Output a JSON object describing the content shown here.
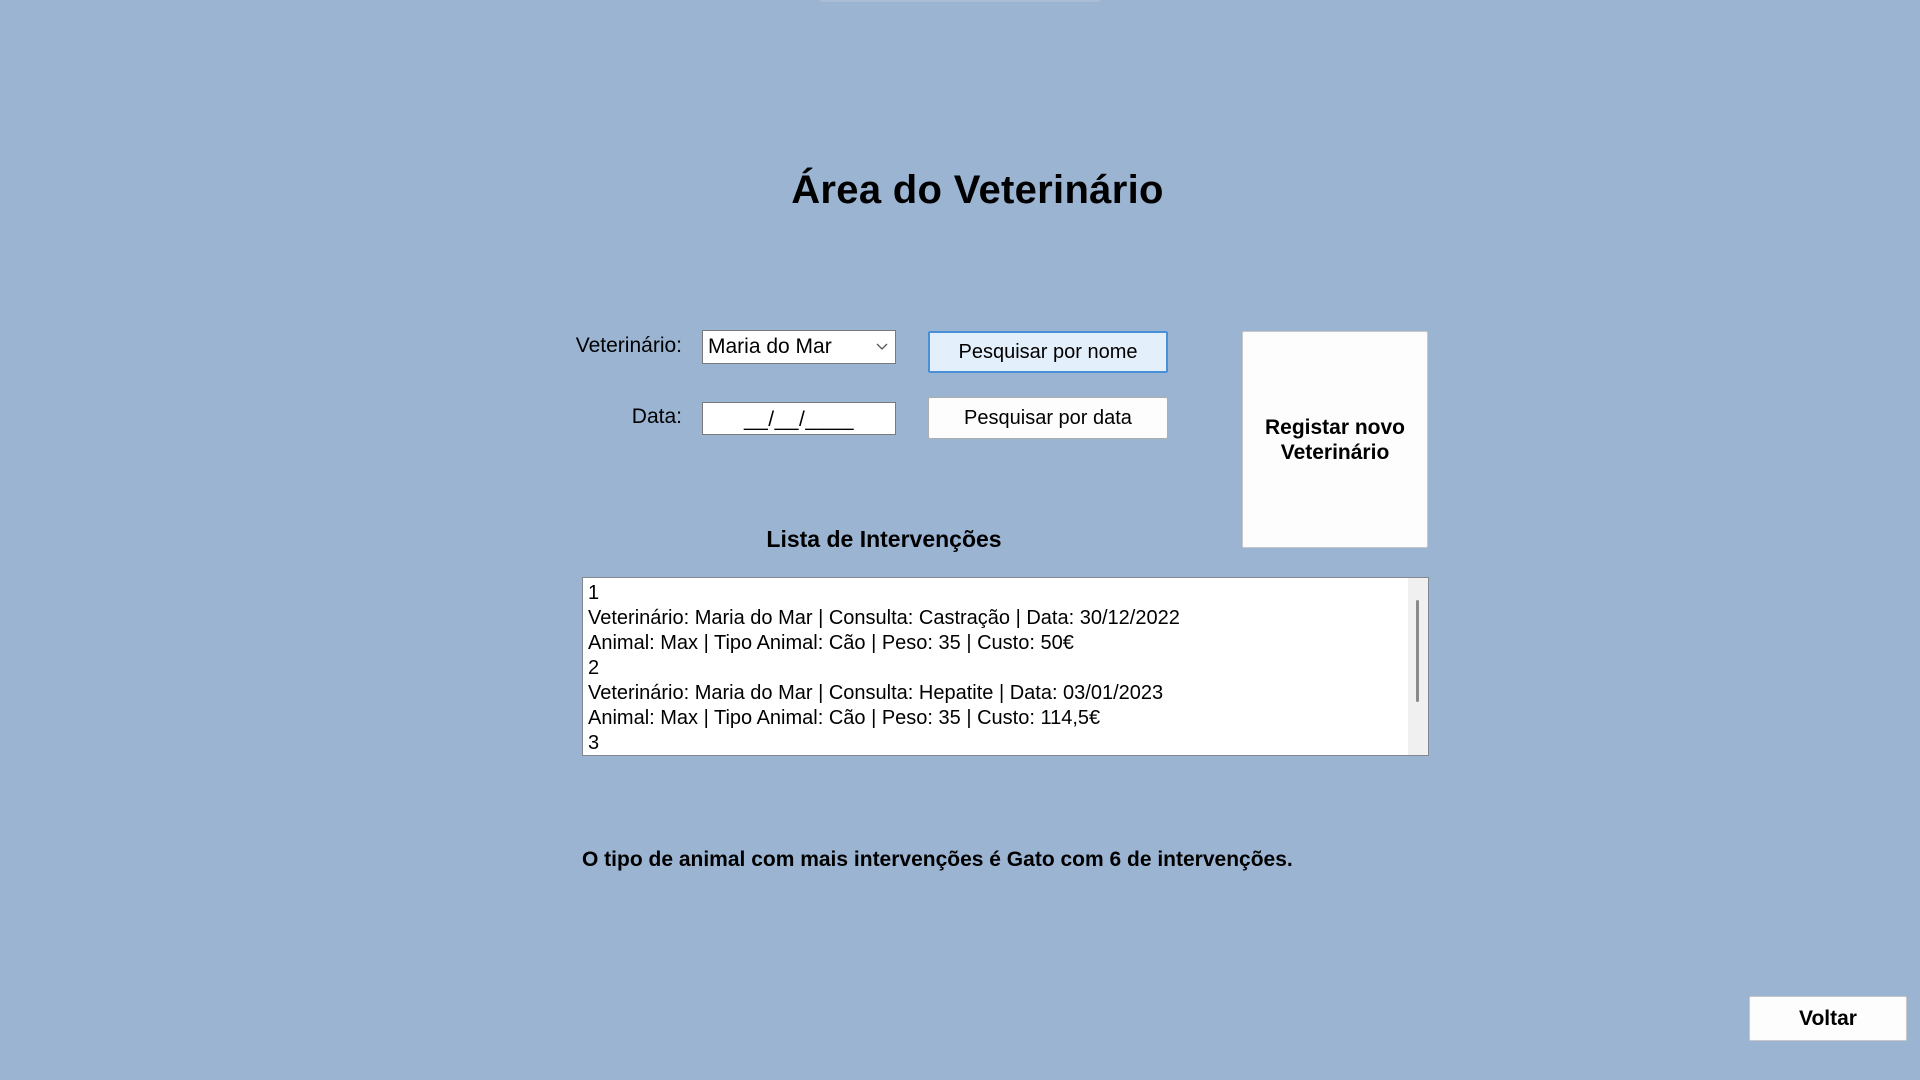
{
  "page": {
    "title": "Área do Veterinário"
  },
  "form": {
    "vet_label": "Veterinário:",
    "vet_selected": "Maria do Mar",
    "date_label": "Data:",
    "date_mask": "__/__/____",
    "search_name_button": "Pesquisar por nome",
    "search_date_button": "Pesquisar por data",
    "register_button_line1": "Registar novo",
    "register_button_line2": "Veterinário"
  },
  "list": {
    "title": "Lista de Intervenções",
    "lines": [
      "1",
      "Veterinário: Maria do Mar | Consulta: Castração | Data: 30/12/2022",
      "Animal: Max | Tipo Animal: Cão | Peso: 35 | Custo: 50€",
      "2",
      "Veterinário: Maria do Mar | Consulta: Hepatite | Data: 03/01/2023",
      "Animal: Max | Tipo Animal: Cão | Peso: 35 | Custo: 114,5€",
      "3"
    ]
  },
  "summary": {
    "text": "O tipo de animal com mais intervenções é Gato com 6 de intervenções."
  },
  "footer": {
    "back_button": "Voltar"
  },
  "icons": {
    "combo_arrow": "chevron-down-icon"
  },
  "colors": {
    "background": "#9bb4d2",
    "focused_button_border": "#4a90d8",
    "focused_button_fill": "#e3effa"
  }
}
